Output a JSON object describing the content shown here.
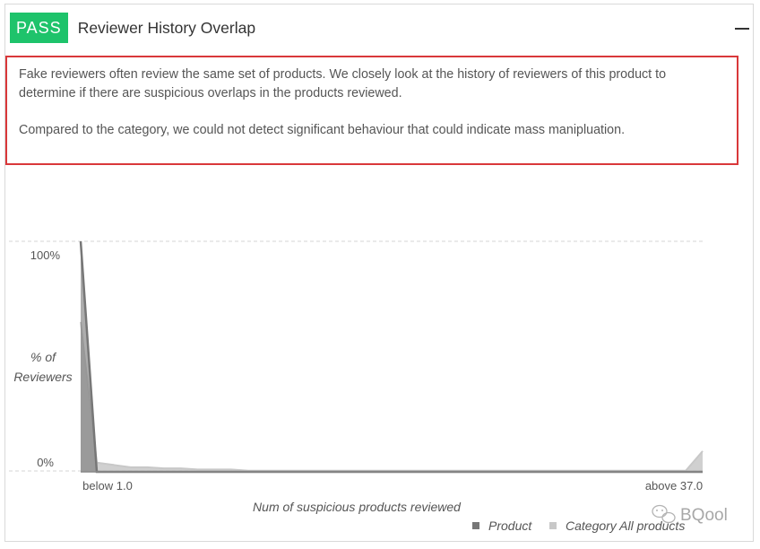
{
  "card": {
    "badge": "PASS",
    "title": "Reviewer History Overlap",
    "description": [
      "Fake reviewers often review the same set of products. We closely look at the history of reviewers of this product to determine if there are suspicious overlaps in the products reviewed.",
      "Compared to the category, we could not detect significant behaviour that could indicate mass manipluation."
    ]
  },
  "chart_data": {
    "type": "area",
    "xlabel": "Num of suspicious products reviewed",
    "ylabel_line1": "% of",
    "ylabel_line2": "Reviewers",
    "y_tick_top": "100%",
    "y_tick_bottom": "0%",
    "x_tick_first": "below 1.0",
    "x_tick_last": "above 37.0",
    "ylim": [
      0,
      100
    ],
    "x_bins": 38,
    "series": [
      {
        "name": "Product",
        "color": "#777777",
        "values": [
          100,
          0,
          0,
          0,
          0,
          0,
          0,
          0,
          0,
          0,
          0,
          0,
          0,
          0,
          0,
          0,
          0,
          0,
          0,
          0,
          0,
          0,
          0,
          0,
          0,
          0,
          0,
          0,
          0,
          0,
          0,
          0,
          0,
          0,
          0,
          0,
          0,
          0
        ]
      },
      {
        "name": "Category All products",
        "color": "#c8c8c8",
        "values": [
          65,
          4,
          3,
          2,
          2,
          1.5,
          1.5,
          1,
          1,
          1,
          0.5,
          0.5,
          0.5,
          0.5,
          0.5,
          0.5,
          0.5,
          0.5,
          0.5,
          0.5,
          0.5,
          0.5,
          0.5,
          0.5,
          0.5,
          0.5,
          0.5,
          0.5,
          0.5,
          0.5,
          0.5,
          0.5,
          0.5,
          0.5,
          0.5,
          0.5,
          0.5,
          9
        ]
      }
    ],
    "legend_position": "bottom-right"
  },
  "watermark": "BQool",
  "colors": {
    "pass": "#1ec36b",
    "highlight_border": "#d9383a"
  }
}
